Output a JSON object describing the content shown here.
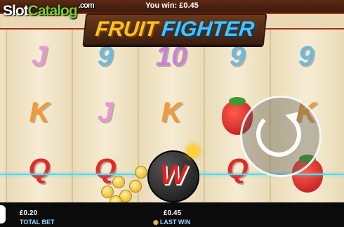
{
  "header": {
    "you_win": "You win: £0.45"
  },
  "watermark": {
    "part1": "Slot",
    "part2": "Catalog",
    "domain": ".com"
  },
  "logo": {
    "word1": "FRUIT",
    "word2": "FIGHTER"
  },
  "reels": [
    {
      "symbols": [
        "J",
        "K",
        "Q"
      ]
    },
    {
      "symbols": [
        "9",
        "J",
        "Q"
      ]
    },
    {
      "symbols": [
        "10",
        "K",
        "W"
      ]
    },
    {
      "symbols": [
        "9",
        "strawberry",
        "Q"
      ]
    },
    {
      "symbols": [
        "9",
        "K",
        "strawberry"
      ]
    }
  ],
  "symbol_text": {
    "r0s0": "J",
    "r0s1": "K",
    "r0s2": "Q",
    "r1s0": "9",
    "r1s1": "J",
    "r1s2": "Q",
    "r2s0": "10",
    "r2s1": "K",
    "r3s0": "9",
    "r3s2": "Q",
    "r4s0": "9",
    "r4s1": "K"
  },
  "wild": {
    "letter": "W"
  },
  "footer": {
    "total_bet_value": "£0.20",
    "total_bet_label": "TOTAL BET",
    "last_win_value": "£0.45",
    "last_win_label": "LAST WIN"
  },
  "colors": {
    "accent": "#a5331c",
    "payline": "#5ad8ef",
    "label": "#9fd5ff"
  },
  "icons": {
    "spin": "refresh-icon",
    "last_win": "coin-icon"
  }
}
